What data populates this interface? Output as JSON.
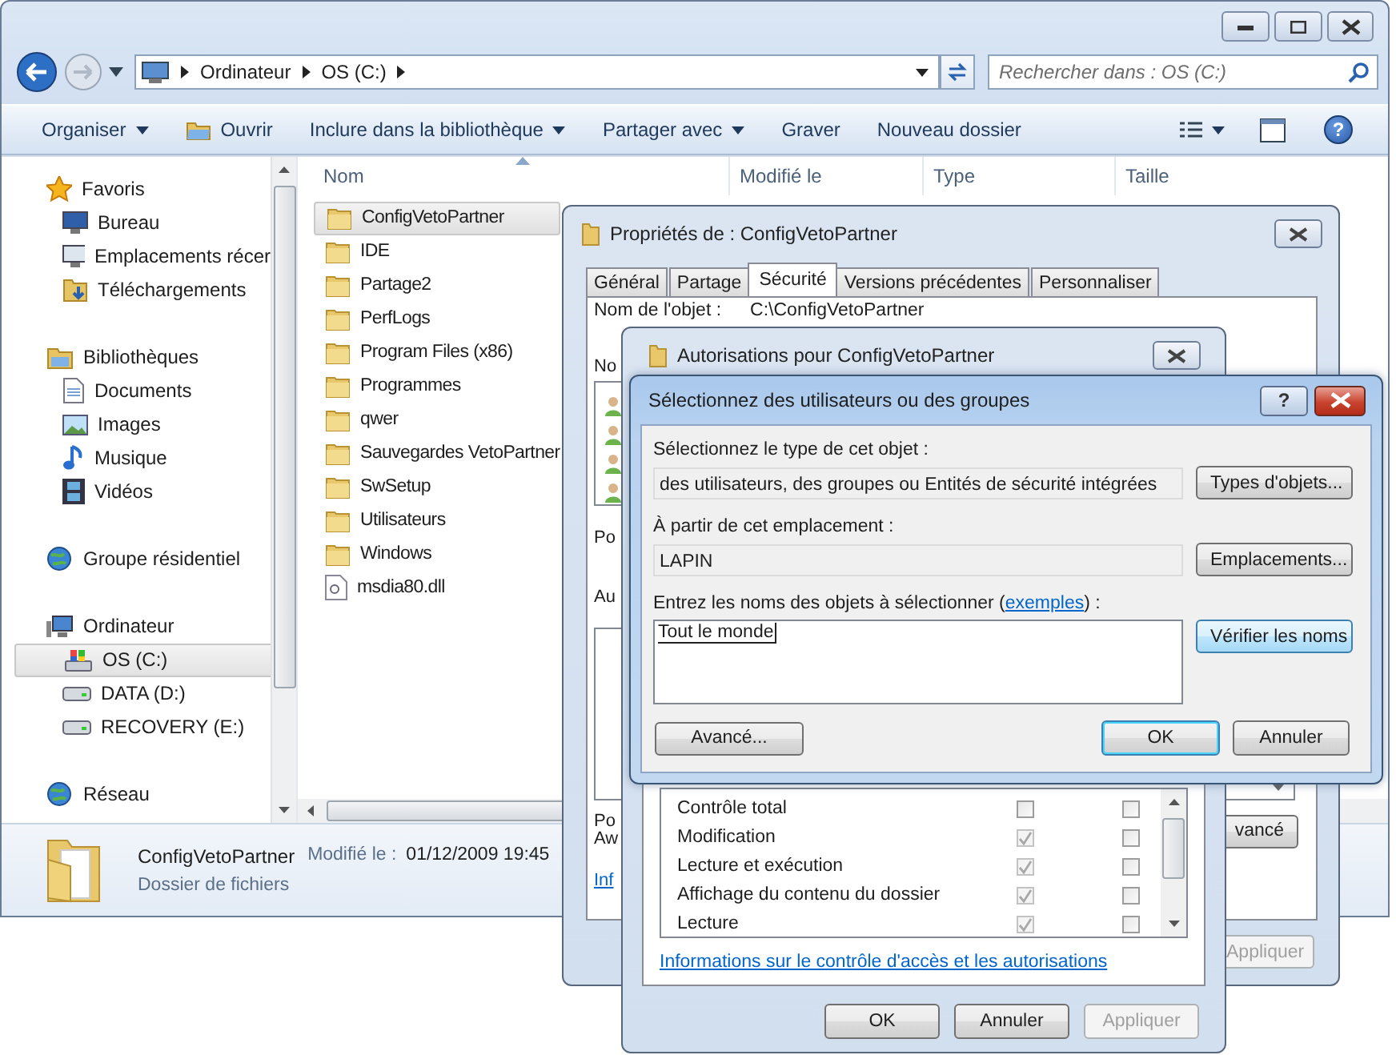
{
  "explorer": {
    "address": {
      "path": [
        "Ordinateur",
        "OS (C:)"
      ]
    },
    "search": {
      "placeholder": "Rechercher dans : OS (C:)"
    },
    "help": "?",
    "toolbar": [
      {
        "label": "Organiser",
        "dropdown": true,
        "kind": "plain"
      },
      {
        "label": "Ouvrir",
        "dropdown": false,
        "kind": "with-icon"
      },
      {
        "label": "Inclure dans la bibliothèque",
        "dropdown": true,
        "kind": "plain"
      },
      {
        "label": "Partager avec",
        "dropdown": true,
        "kind": "plain"
      },
      {
        "label": "Graver",
        "dropdown": false,
        "kind": "plain"
      },
      {
        "label": "Nouveau dossier",
        "dropdown": false,
        "kind": "plain"
      }
    ],
    "sidebar": [
      {
        "label": "Favoris",
        "kind": "star",
        "selected": false,
        "children": [
          {
            "label": "Bureau",
            "kind": "desktop",
            "selected": false
          },
          {
            "label": "Emplacements récer",
            "kind": "recent",
            "selected": false
          },
          {
            "label": "Téléchargements",
            "kind": "downloads",
            "selected": false
          }
        ]
      },
      {
        "label": "Bibliothèques",
        "kind": "libraries",
        "selected": false,
        "children": [
          {
            "label": "Documents",
            "kind": "documents",
            "selected": false
          },
          {
            "label": "Images",
            "kind": "images",
            "selected": false
          },
          {
            "label": "Musique",
            "kind": "music",
            "selected": false
          },
          {
            "label": "Vidéos",
            "kind": "videos",
            "selected": false
          }
        ]
      },
      {
        "label": "Groupe résidentiel",
        "kind": "homegroup",
        "selected": false
      },
      {
        "label": "Ordinateur",
        "kind": "computer",
        "selected": false,
        "children": [
          {
            "label": "OS (C:)",
            "kind": "os-drive",
            "selected": true
          },
          {
            "label": "DATA (D:)",
            "kind": "drive",
            "selected": false
          },
          {
            "label": "RECOVERY (E:)",
            "kind": "drive",
            "selected": false
          }
        ]
      },
      {
        "label": "Réseau",
        "kind": "network",
        "selected": false
      }
    ],
    "columns": [
      "Nom",
      "Modifié le",
      "Type",
      "Taille"
    ],
    "files": [
      {
        "name": "ConfigVetoPartner",
        "kind": "folder",
        "selected": true
      },
      {
        "name": "IDE",
        "kind": "folder",
        "selected": false
      },
      {
        "name": "Partage2",
        "kind": "folder",
        "selected": false
      },
      {
        "name": "PerfLogs",
        "kind": "folder",
        "selected": false
      },
      {
        "name": "Program Files (x86)",
        "kind": "folder",
        "selected": false
      },
      {
        "name": "Programmes",
        "kind": "folder",
        "selected": false
      },
      {
        "name": "qwer",
        "kind": "folder",
        "selected": false
      },
      {
        "name": "Sauvegardes VetoPartner",
        "kind": "folder",
        "selected": false
      },
      {
        "name": "SwSetup",
        "kind": "folder",
        "selected": false
      },
      {
        "name": "Utilisateurs",
        "kind": "folder",
        "selected": false
      },
      {
        "name": "Windows",
        "kind": "folder",
        "selected": false
      },
      {
        "name": "msdia80.dll",
        "kind": "file",
        "selected": false
      }
    ],
    "details": {
      "name": "ConfigVetoPartner",
      "modified_label": "Modifié le :",
      "modified": "01/12/2009 19:45",
      "type": "Dossier de fichiers"
    }
  },
  "properties": {
    "title": "Propriétés de : ConfigVetoPartner",
    "tabs": [
      {
        "label": "Général",
        "selected": false
      },
      {
        "label": "Partage",
        "selected": false
      },
      {
        "label": "Sécurité",
        "selected": true
      },
      {
        "label": "Versions précédentes",
        "selected": false
      },
      {
        "label": "Personnaliser",
        "selected": false
      }
    ],
    "object_label": "Nom de l'objet :",
    "object_value": "C:\\ConfigVetoPartner",
    "fragments": {
      "names": "No",
      "for": "Po",
      "auth": "Au",
      "special_1": "Po",
      "special_2": "Aw",
      "info": "Inf"
    },
    "advanced": "vancé",
    "apply": {
      "label": "Appliquer",
      "disabled": true
    }
  },
  "permissions_dialog": {
    "title": "Autorisations pour ConfigVetoPartner",
    "rows": [
      {
        "label": "Contrôle total",
        "allow": false,
        "allow_disabled": false,
        "deny": false
      },
      {
        "label": "Modification",
        "allow": true,
        "allow_disabled": true,
        "deny": false
      },
      {
        "label": "Lecture et exécution",
        "allow": true,
        "allow_disabled": true,
        "deny": false
      },
      {
        "label": "Affichage du contenu du dossier",
        "allow": true,
        "allow_disabled": true,
        "deny": false
      },
      {
        "label": "Lecture",
        "allow": true,
        "allow_disabled": true,
        "deny": false
      }
    ],
    "link": "Informations sur le contrôle d'accès et les autorisations",
    "buttons": [
      {
        "label": "OK",
        "disabled": false
      },
      {
        "label": "Annuler",
        "disabled": false
      },
      {
        "label": "Appliquer",
        "disabled": true
      }
    ]
  },
  "select_dialog": {
    "title": "Sélectionnez des utilisateurs ou des groupes",
    "type_label": "Sélectionnez le type de cet objet :",
    "type_value": "des utilisateurs, des groupes ou Entités de sécurité intégrées",
    "type_button": "Types d'objets...",
    "location_label": "À partir de cet emplacement :",
    "location_value": "LAPIN",
    "location_button": "Emplacements...",
    "names_label": {
      "before": "Entrez les noms des objets à sélectionner (",
      "link": "exemples",
      "after": ") :"
    },
    "names_value": "Tout le monde",
    "check_button": "Vérifier les noms",
    "advanced_button": "Avancé...",
    "ok": "OK",
    "cancel": "Annuler",
    "help": "?"
  }
}
